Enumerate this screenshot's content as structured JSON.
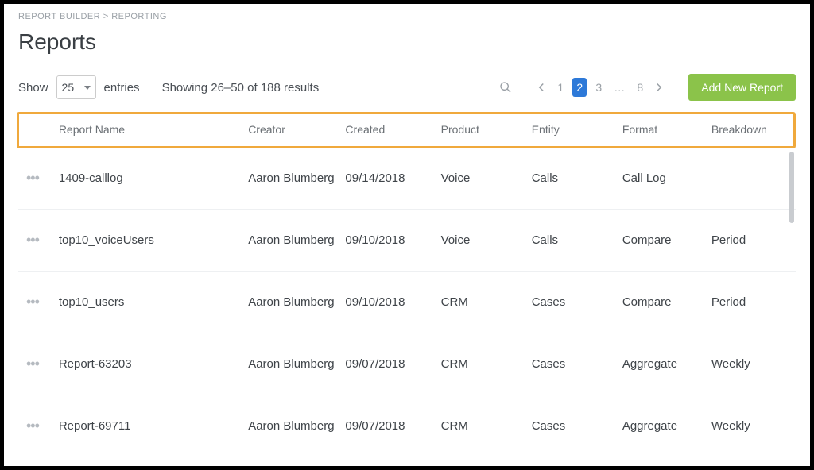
{
  "breadcrumb": "REPORT BUILDER > REPORTING",
  "page_title": "Reports",
  "controls": {
    "show_label": "Show",
    "page_size": "25",
    "entries_label": "entries",
    "results_summary": "Showing 26–50 of 188 results"
  },
  "pagination": {
    "pages_left": [
      "1"
    ],
    "current": "2",
    "pages_right": [
      "3"
    ],
    "ellipsis": "…",
    "last": "8"
  },
  "add_button": "Add New Report",
  "table": {
    "headers": {
      "name": "Report Name",
      "creator": "Creator",
      "created": "Created",
      "product": "Product",
      "entity": "Entity",
      "format": "Format",
      "breakdown": "Breakdown"
    },
    "rows": [
      {
        "name": "1409-calllog",
        "creator": "Aaron Blumberg",
        "created": "09/14/2018",
        "product": "Voice",
        "entity": "Calls",
        "format": "Call Log",
        "breakdown": ""
      },
      {
        "name": "top10_voiceUsers",
        "creator": "Aaron Blumberg",
        "created": "09/10/2018",
        "product": "Voice",
        "entity": "Calls",
        "format": "Compare",
        "breakdown": "Period"
      },
      {
        "name": "top10_users",
        "creator": "Aaron Blumberg",
        "created": "09/10/2018",
        "product": "CRM",
        "entity": "Cases",
        "format": "Compare",
        "breakdown": "Period"
      },
      {
        "name": "Report-63203",
        "creator": "Aaron Blumberg",
        "created": "09/07/2018",
        "product": "CRM",
        "entity": "Cases",
        "format": "Aggregate",
        "breakdown": "Weekly"
      },
      {
        "name": "Report-69711",
        "creator": "Aaron Blumberg",
        "created": "09/07/2018",
        "product": "CRM",
        "entity": "Cases",
        "format": "Aggregate",
        "breakdown": "Weekly"
      }
    ]
  }
}
